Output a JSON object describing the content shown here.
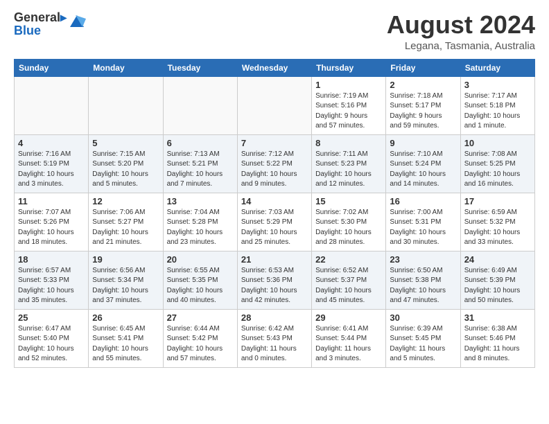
{
  "header": {
    "logo_line1": "General",
    "logo_line2": "Blue",
    "month_year": "August 2024",
    "location": "Legana, Tasmania, Australia"
  },
  "weekdays": [
    "Sunday",
    "Monday",
    "Tuesday",
    "Wednesday",
    "Thursday",
    "Friday",
    "Saturday"
  ],
  "weeks": [
    [
      {
        "day": "",
        "info": ""
      },
      {
        "day": "",
        "info": ""
      },
      {
        "day": "",
        "info": ""
      },
      {
        "day": "",
        "info": ""
      },
      {
        "day": "1",
        "info": "Sunrise: 7:19 AM\nSunset: 5:16 PM\nDaylight: 9 hours\nand 57 minutes."
      },
      {
        "day": "2",
        "info": "Sunrise: 7:18 AM\nSunset: 5:17 PM\nDaylight: 9 hours\nand 59 minutes."
      },
      {
        "day": "3",
        "info": "Sunrise: 7:17 AM\nSunset: 5:18 PM\nDaylight: 10 hours\nand 1 minute."
      }
    ],
    [
      {
        "day": "4",
        "info": "Sunrise: 7:16 AM\nSunset: 5:19 PM\nDaylight: 10 hours\nand 3 minutes."
      },
      {
        "day": "5",
        "info": "Sunrise: 7:15 AM\nSunset: 5:20 PM\nDaylight: 10 hours\nand 5 minutes."
      },
      {
        "day": "6",
        "info": "Sunrise: 7:13 AM\nSunset: 5:21 PM\nDaylight: 10 hours\nand 7 minutes."
      },
      {
        "day": "7",
        "info": "Sunrise: 7:12 AM\nSunset: 5:22 PM\nDaylight: 10 hours\nand 9 minutes."
      },
      {
        "day": "8",
        "info": "Sunrise: 7:11 AM\nSunset: 5:23 PM\nDaylight: 10 hours\nand 12 minutes."
      },
      {
        "day": "9",
        "info": "Sunrise: 7:10 AM\nSunset: 5:24 PM\nDaylight: 10 hours\nand 14 minutes."
      },
      {
        "day": "10",
        "info": "Sunrise: 7:08 AM\nSunset: 5:25 PM\nDaylight: 10 hours\nand 16 minutes."
      }
    ],
    [
      {
        "day": "11",
        "info": "Sunrise: 7:07 AM\nSunset: 5:26 PM\nDaylight: 10 hours\nand 18 minutes."
      },
      {
        "day": "12",
        "info": "Sunrise: 7:06 AM\nSunset: 5:27 PM\nDaylight: 10 hours\nand 21 minutes."
      },
      {
        "day": "13",
        "info": "Sunrise: 7:04 AM\nSunset: 5:28 PM\nDaylight: 10 hours\nand 23 minutes."
      },
      {
        "day": "14",
        "info": "Sunrise: 7:03 AM\nSunset: 5:29 PM\nDaylight: 10 hours\nand 25 minutes."
      },
      {
        "day": "15",
        "info": "Sunrise: 7:02 AM\nSunset: 5:30 PM\nDaylight: 10 hours\nand 28 minutes."
      },
      {
        "day": "16",
        "info": "Sunrise: 7:00 AM\nSunset: 5:31 PM\nDaylight: 10 hours\nand 30 minutes."
      },
      {
        "day": "17",
        "info": "Sunrise: 6:59 AM\nSunset: 5:32 PM\nDaylight: 10 hours\nand 33 minutes."
      }
    ],
    [
      {
        "day": "18",
        "info": "Sunrise: 6:57 AM\nSunset: 5:33 PM\nDaylight: 10 hours\nand 35 minutes."
      },
      {
        "day": "19",
        "info": "Sunrise: 6:56 AM\nSunset: 5:34 PM\nDaylight: 10 hours\nand 37 minutes."
      },
      {
        "day": "20",
        "info": "Sunrise: 6:55 AM\nSunset: 5:35 PM\nDaylight: 10 hours\nand 40 minutes."
      },
      {
        "day": "21",
        "info": "Sunrise: 6:53 AM\nSunset: 5:36 PM\nDaylight: 10 hours\nand 42 minutes."
      },
      {
        "day": "22",
        "info": "Sunrise: 6:52 AM\nSunset: 5:37 PM\nDaylight: 10 hours\nand 45 minutes."
      },
      {
        "day": "23",
        "info": "Sunrise: 6:50 AM\nSunset: 5:38 PM\nDaylight: 10 hours\nand 47 minutes."
      },
      {
        "day": "24",
        "info": "Sunrise: 6:49 AM\nSunset: 5:39 PM\nDaylight: 10 hours\nand 50 minutes."
      }
    ],
    [
      {
        "day": "25",
        "info": "Sunrise: 6:47 AM\nSunset: 5:40 PM\nDaylight: 10 hours\nand 52 minutes."
      },
      {
        "day": "26",
        "info": "Sunrise: 6:45 AM\nSunset: 5:41 PM\nDaylight: 10 hours\nand 55 minutes."
      },
      {
        "day": "27",
        "info": "Sunrise: 6:44 AM\nSunset: 5:42 PM\nDaylight: 10 hours\nand 57 minutes."
      },
      {
        "day": "28",
        "info": "Sunrise: 6:42 AM\nSunset: 5:43 PM\nDaylight: 11 hours\nand 0 minutes."
      },
      {
        "day": "29",
        "info": "Sunrise: 6:41 AM\nSunset: 5:44 PM\nDaylight: 11 hours\nand 3 minutes."
      },
      {
        "day": "30",
        "info": "Sunrise: 6:39 AM\nSunset: 5:45 PM\nDaylight: 11 hours\nand 5 minutes."
      },
      {
        "day": "31",
        "info": "Sunrise: 6:38 AM\nSunset: 5:46 PM\nDaylight: 11 hours\nand 8 minutes."
      }
    ]
  ]
}
